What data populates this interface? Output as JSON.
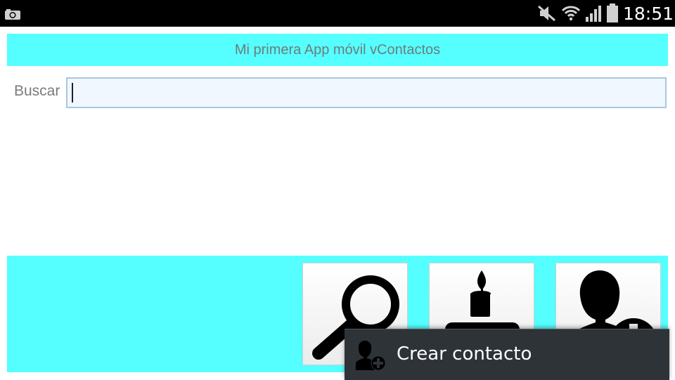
{
  "status_bar": {
    "time": "18:51",
    "icons": [
      "camera-icon",
      "mute-icon",
      "wifi-icon",
      "signal-icon",
      "battery-icon"
    ]
  },
  "app": {
    "title": "Mi primera App móvil vContactos"
  },
  "search": {
    "label": "Buscar",
    "value": "",
    "placeholder": ""
  },
  "toolbar": {
    "buttons": [
      {
        "icon": "magnifier-icon"
      },
      {
        "icon": "birthday-candle-icon"
      },
      {
        "icon": "add-contact-icon"
      }
    ]
  },
  "popup": {
    "icon": "add-contact-icon",
    "label": "Crear contacto"
  },
  "colors": {
    "accent": "#55ffff",
    "popup_bg": "#2e3338",
    "input_border": "#a9c6e0"
  }
}
